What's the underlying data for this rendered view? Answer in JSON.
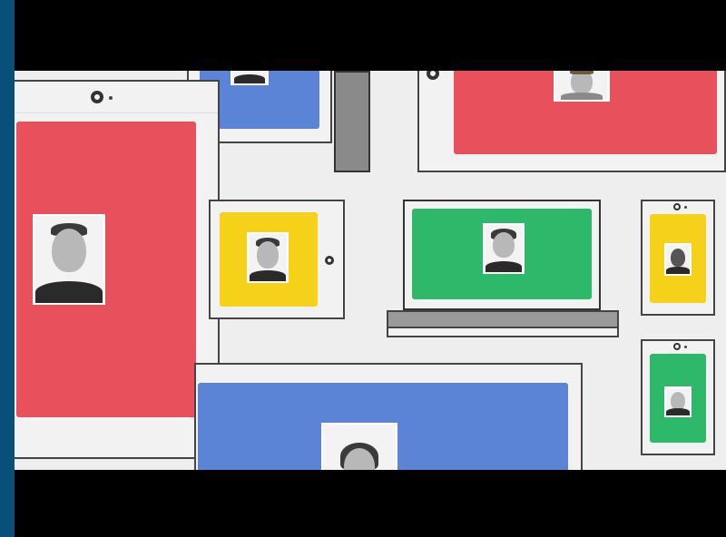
{
  "scene": {
    "description_tags": [
      "devices",
      "photos",
      "students"
    ],
    "colors": {
      "red": "#e8505b",
      "blue": "#5b83d6",
      "yellow": "#f5d11a",
      "green": "#2db86a",
      "background": "#eeeeef",
      "letterbox": "#000000",
      "outer_border": "#0a4f7a"
    },
    "devices": [
      {
        "name": "large-red-tablet",
        "color": "red"
      },
      {
        "name": "blue-monitor-top",
        "color": "blue"
      },
      {
        "name": "red-monitor-top-right",
        "color": "red"
      },
      {
        "name": "yellow-tablet",
        "color": "yellow"
      },
      {
        "name": "green-laptop",
        "color": "green"
      },
      {
        "name": "yellow-phone",
        "color": "yellow"
      },
      {
        "name": "green-phone",
        "color": "green"
      },
      {
        "name": "blue-monitor-bottom",
        "color": "blue"
      }
    ]
  }
}
